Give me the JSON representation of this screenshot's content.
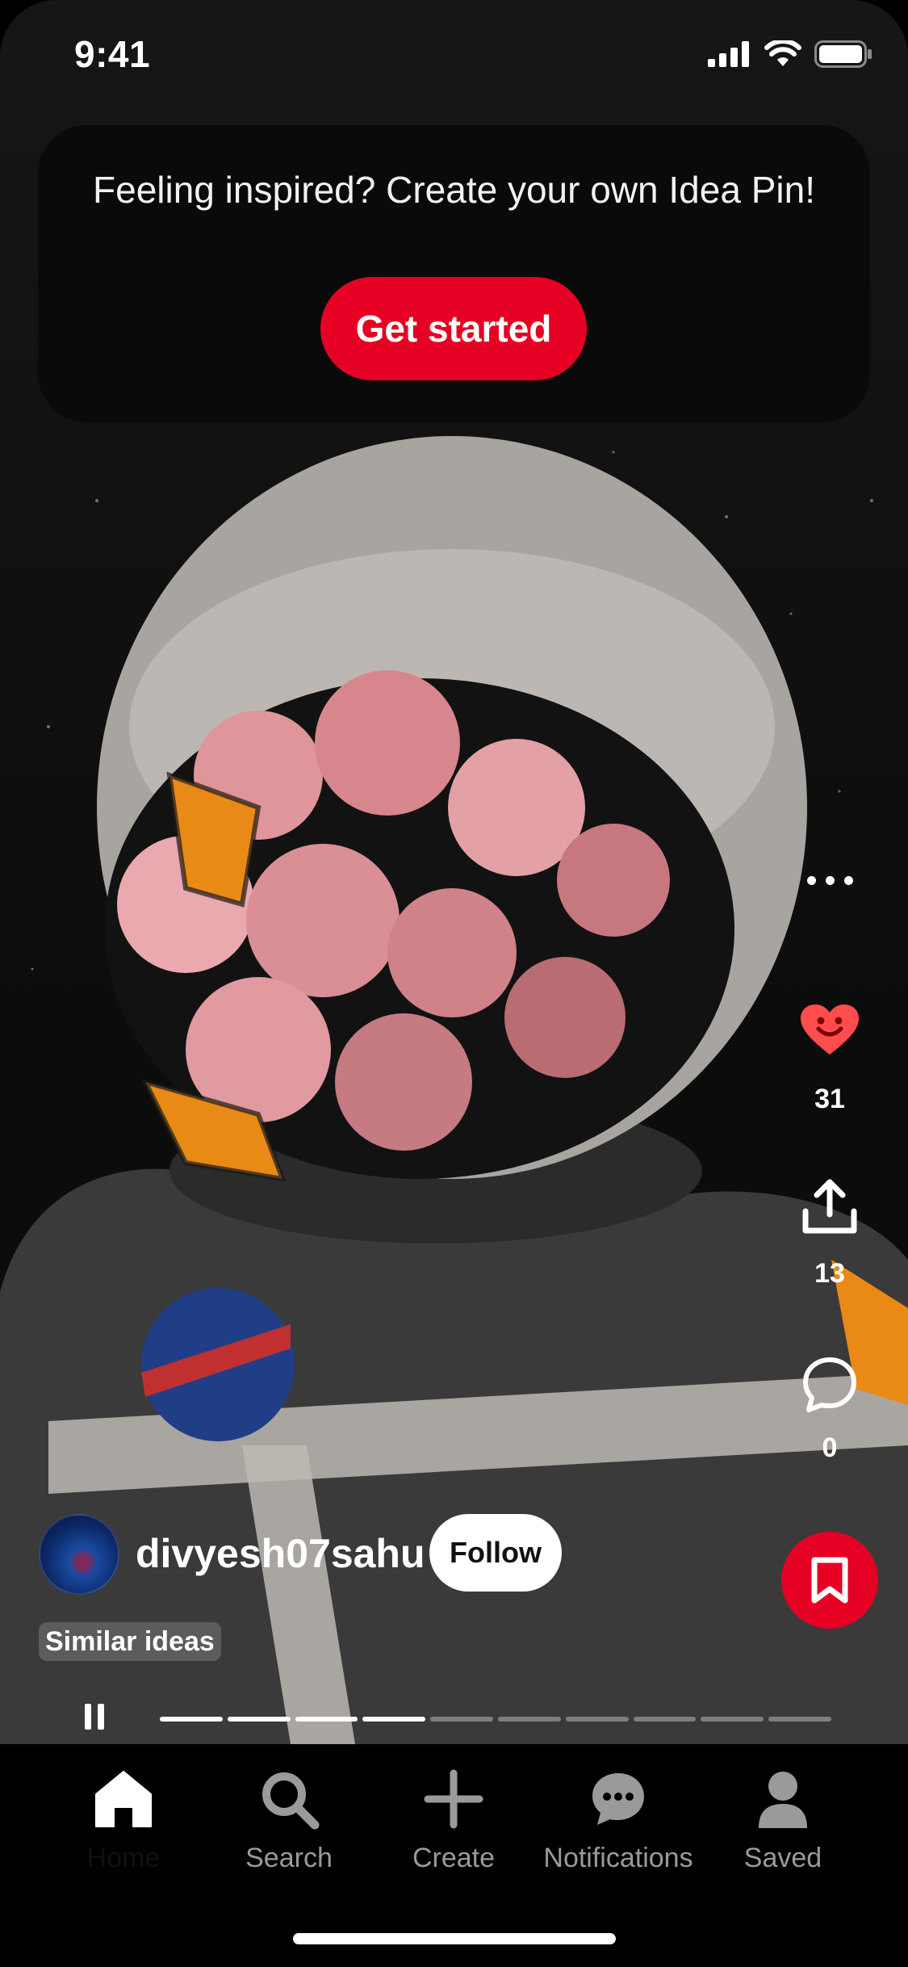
{
  "status_bar": {
    "time": "9:41"
  },
  "promo": {
    "text": "Feeling inspired? Create your own Idea Pin!",
    "button_label": "Get started"
  },
  "actions": {
    "reactions_count": "31",
    "shares_count": "13",
    "comments_count": "0"
  },
  "creator": {
    "username": "divyesh07sahu",
    "follow_label": "Follow"
  },
  "similar_label": "Similar ideas",
  "progress": {
    "total_segments": 10,
    "completed_segments": 4
  },
  "nav": {
    "items": [
      {
        "label": "Home",
        "icon": "home-icon",
        "active": true
      },
      {
        "label": "Search",
        "icon": "search-icon",
        "active": false
      },
      {
        "label": "Create",
        "icon": "plus-icon",
        "active": false
      },
      {
        "label": "Notifications",
        "icon": "chat-icon",
        "active": false
      },
      {
        "label": "Saved",
        "icon": "profile-icon",
        "active": false
      }
    ]
  },
  "colors": {
    "accent": "#e60023",
    "background": "#000000"
  }
}
